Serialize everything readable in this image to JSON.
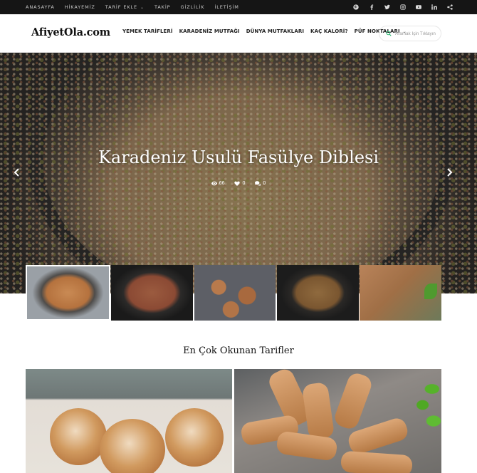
{
  "topnav": {
    "items": [
      "ANASAYFA",
      "HİKAYEMİZ",
      "TARİF EKLE",
      "TAKİP",
      "GİZLİLİK",
      "İLETİŞİM"
    ]
  },
  "social": [
    "pinterest-icon",
    "facebook-icon",
    "twitter-icon",
    "instagram-icon",
    "youtube-icon",
    "linkedin-icon",
    "share-icon"
  ],
  "header": {
    "logo": "AfiyetOla.com",
    "nav": [
      "YEMEK TARİFLERİ",
      "KARADENİZ MUTFAĞI",
      "DÜNYA MUTFAKLARI",
      "KAÇ KALORİ?",
      "PÜF NOKTALARI"
    ]
  },
  "search": {
    "placeholder": "Aramak İçin Tıklayın"
  },
  "hero": {
    "title": "Karadeniz Usulü Fasülye Diblesi",
    "views": "66",
    "likes": "0",
    "comments": "0"
  },
  "section": {
    "title": "En Çok Okunan Tarifler"
  },
  "colors": {
    "topbar": "#151515",
    "accent": "#2bb673"
  }
}
